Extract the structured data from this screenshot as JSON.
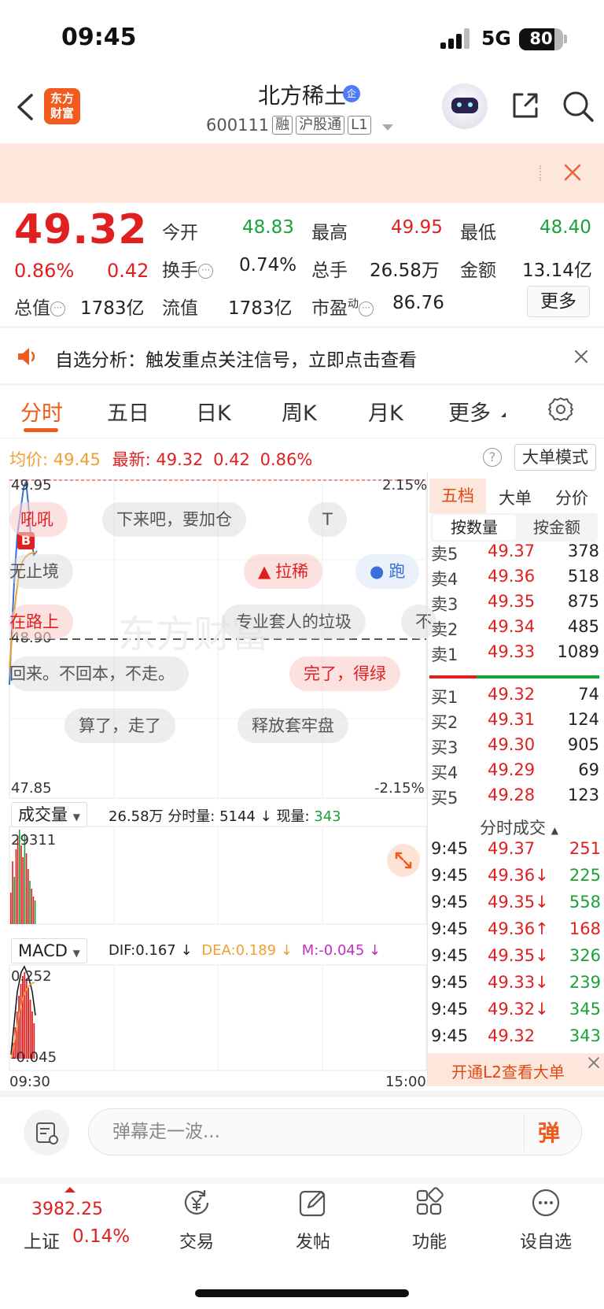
{
  "status_bar": {
    "time": "09:45",
    "network": "5G",
    "battery": "80",
    "battery_level": 80
  },
  "header": {
    "app_logo_line1": "东方",
    "app_logo_line2": "财富",
    "stock_name": "北方稀土",
    "name_badge": "企",
    "code": "600111",
    "tags": [
      "融",
      "沪股通",
      "L1"
    ]
  },
  "quote": {
    "price": "49.32",
    "change_pct": "0.86%",
    "change": "0.42",
    "fields": {
      "open_label": "今开",
      "open": "48.83",
      "high_label": "最高",
      "high": "49.95",
      "low_label": "最低",
      "low": "48.40",
      "turnover_label": "换手",
      "turnover": "0.74%",
      "volume_label": "总手",
      "volume": "26.58万",
      "amount_label": "金额",
      "amount": "13.14亿",
      "mktcap_label": "总值",
      "mktcap": "1783亿",
      "float_label": "流值",
      "float": "1783亿",
      "pe_label": "市盈",
      "pe_super": "动",
      "pe": "86.76"
    },
    "more_button": "更多"
  },
  "alert": {
    "text": "自选分析：触发重点关注信号，立即点击查看"
  },
  "chart_tabs": [
    "分时",
    "五日",
    "日K",
    "周K",
    "月K",
    "更多"
  ],
  "info_line": {
    "avg_label": "均价:",
    "avg": "49.45",
    "latest_label": "最新:",
    "latest": "49.32",
    "latest_chg": "0.42",
    "latest_pct": "0.86%",
    "big_order_mode": "大单模式"
  },
  "intraday_chart": {
    "top_left": "49.95",
    "top_right": "2.15%",
    "mid_left": "48.90",
    "bottom_left": "47.85",
    "bottom_right": "-2.15%",
    "marker": "B"
  },
  "danmu": [
    {
      "text": "吼吼",
      "hot": true
    },
    {
      "text": "下来吧，要加仓",
      "hot": false
    },
    {
      "text": "T",
      "hot": false
    },
    {
      "text": "无止境",
      "hot": false
    },
    {
      "text": "拉稀",
      "hot": true
    },
    {
      "text": "跑",
      "hot": false
    },
    {
      "text": "在路上",
      "hot": true
    },
    {
      "text": "专业套人的垃圾",
      "hot": false
    },
    {
      "text": "不",
      "hot": false
    },
    {
      "text": "回来。不回本，不走。",
      "hot": false
    },
    {
      "text": "完了，得绿",
      "hot": true
    },
    {
      "text": "算了，走了",
      "hot": false
    },
    {
      "text": "释放套牢盘",
      "hot": false
    }
  ],
  "volume_panel": {
    "label": "成交量",
    "total": "26.58万",
    "minute_label": "分时量:",
    "minute": "5144",
    "now_label": "现量:",
    "now": "343",
    "max": "29311"
  },
  "macd_panel": {
    "label": "MACD",
    "dif": "DIF:0.167",
    "dea": "DEA:0.189",
    "m": "M:-0.045",
    "top": "0.252",
    "bottom": "-0.045"
  },
  "time_axis": {
    "start": "09:30",
    "end": "15:00"
  },
  "order_book": {
    "tabs": [
      "五档",
      "大单",
      "分价"
    ],
    "seg": [
      "按数量",
      "按金额"
    ],
    "asks": [
      {
        "label": "卖5",
        "price": "49.37",
        "qty": "378"
      },
      {
        "label": "卖4",
        "price": "49.36",
        "qty": "518"
      },
      {
        "label": "卖3",
        "price": "49.35",
        "qty": "875"
      },
      {
        "label": "卖2",
        "price": "49.34",
        "qty": "485"
      },
      {
        "label": "卖1",
        "price": "49.33",
        "qty": "1089"
      }
    ],
    "bids": [
      {
        "label": "买1",
        "price": "49.32",
        "qty": "74"
      },
      {
        "label": "买2",
        "price": "49.31",
        "qty": "124"
      },
      {
        "label": "买3",
        "price": "49.30",
        "qty": "905"
      },
      {
        "label": "买4",
        "price": "49.29",
        "qty": "69"
      },
      {
        "label": "买5",
        "price": "49.28",
        "qty": "123"
      }
    ]
  },
  "trades": {
    "title": "分时成交",
    "rows": [
      {
        "time": "9:45",
        "price": "49.37",
        "vol": "251",
        "dir": "up"
      },
      {
        "time": "9:45",
        "price": "49.36↓",
        "vol": "225",
        "dir": "down"
      },
      {
        "time": "9:45",
        "price": "49.35↓",
        "vol": "558",
        "dir": "down"
      },
      {
        "time": "9:45",
        "price": "49.36↑",
        "vol": "168",
        "dir": "up"
      },
      {
        "time": "9:45",
        "price": "49.35↓",
        "vol": "326",
        "dir": "down"
      },
      {
        "time": "9:45",
        "price": "49.33↓",
        "vol": "239",
        "dir": "down"
      },
      {
        "time": "9:45",
        "price": "49.32↓",
        "vol": "345",
        "dir": "down"
      },
      {
        "time": "9:45",
        "price": "49.32",
        "vol": "343",
        "dir": "down"
      }
    ],
    "l2_banner": "开通L2查看大单"
  },
  "danmu_input": {
    "placeholder": "弹幕走一波...",
    "button": "弹"
  },
  "bottom_nav": {
    "index_value": "3982.25",
    "index_name": "上证",
    "index_pct": "0.14%",
    "items": [
      "交易",
      "发帖",
      "功能",
      "设自选"
    ]
  },
  "colors": {
    "up": "#e02020",
    "down": "#1aa23a",
    "accent": "#f05a1a",
    "avg_line": "#f0a030",
    "price_line": "#3a6fd8"
  }
}
